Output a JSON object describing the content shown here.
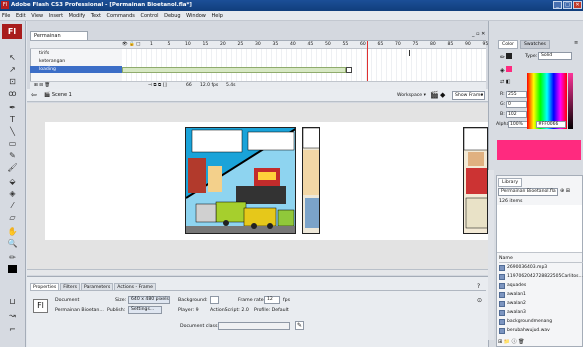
{
  "window": {
    "title": "Adobe Flash CS3 Professional - [Permainan Bioetanol.fla*]"
  },
  "menu": [
    "File",
    "Edit",
    "View",
    "Insert",
    "Modify",
    "Text",
    "Commands",
    "Control",
    "Debug",
    "Window",
    "Help"
  ],
  "doc_tab": "Permainan Bioetanol.fla*",
  "timeline": {
    "frame_numbers": [
      "1",
      "5",
      "10",
      "15",
      "20",
      "25",
      "30",
      "35",
      "40",
      "45",
      "50",
      "55",
      "60",
      "65",
      "70",
      "75",
      "80",
      "85",
      "90",
      "95"
    ],
    "layers": [
      {
        "name": "tirifs",
        "selected": false
      },
      {
        "name": "keterangan",
        "selected": false
      },
      {
        "name": "loading",
        "selected": true
      }
    ],
    "footer": {
      "frame": "66",
      "fps": "12.0 fps",
      "time": "5.4s"
    }
  },
  "edit_bar": {
    "scene": "Scene 1",
    "workspace": "Workspace",
    "zoom": "Show Frame"
  },
  "properties": {
    "tabs": [
      "Properties",
      "Filters",
      "Parameters",
      "Actions - Frame"
    ],
    "doc_label": "Document",
    "doc_name": "Permainan Bioetan...",
    "size_label": "Size:",
    "size_value": "640 x 480 pixels",
    "publish_label": "Publish:",
    "settings_button": "Settings...",
    "background_label": "Background:",
    "framerate_label": "Frame rate:",
    "framerate_value": "12",
    "fps": "fps",
    "player": "Player: 9",
    "actionscript": "ActionScript: 2.0",
    "profile": "Profile: Default",
    "docclass_label": "Document class:",
    "docclass_value": ""
  },
  "color_panel": {
    "tabs": [
      "Color",
      "Swatches"
    ],
    "type_label": "Type:",
    "type_value": "Solid",
    "r_label": "R:",
    "r_value": "255",
    "g_label": "G:",
    "g_value": "0",
    "b_label": "B:",
    "b_value": "102",
    "alpha_label": "Alpha:",
    "alpha_value": "100%",
    "hex_value": "#FF0066",
    "swatch_color": "#ff2a7f"
  },
  "library": {
    "tab": "Library",
    "doc_select": "Permainan Bioetanol.fla",
    "item_count": "126 items",
    "name_header": "Name",
    "items": [
      "2690036403.mp3",
      "1197062042728822505Carlitos...",
      "aquades",
      "awalan1",
      "awalan2",
      "awalan3",
      "backgroundmenang",
      "berubahwujud.wav"
    ]
  }
}
